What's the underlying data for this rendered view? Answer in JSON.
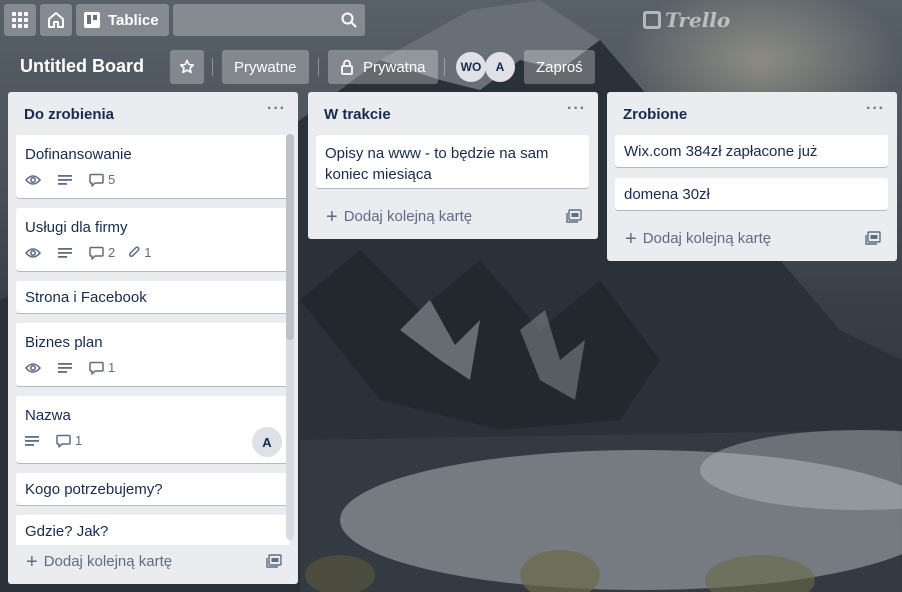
{
  "nav": {
    "boards_label": "Tablice",
    "search_placeholder": "",
    "logo_text": "Trello"
  },
  "board": {
    "title": "Untitled Board",
    "visibility_team": "Prywatne",
    "visibility_private": "Prywatna",
    "members": [
      "WO",
      "A"
    ],
    "invite_label": "Zaproś"
  },
  "lists": [
    {
      "title": "Do zrobienia",
      "cards": [
        {
          "title": "Dofinansowanie",
          "comments": "5"
        },
        {
          "title": "Usługi dla firmy",
          "comments": "2",
          "attachments": "1"
        },
        {
          "title": "Strona i Facebook"
        },
        {
          "title": "Biznes plan",
          "comments": "1"
        },
        {
          "title": "Nazwa",
          "comments": "1",
          "member": "A"
        },
        {
          "title": "Kogo potrzebujemy?"
        },
        {
          "title": "Gdzie? Jak?"
        }
      ],
      "add_label": "Dodaj kolejną kartę"
    },
    {
      "title": "W trakcie",
      "cards": [
        {
          "title": "Opisy na www - to będzie na sam koniec miesiąca"
        }
      ],
      "add_label": "Dodaj kolejną kartę"
    },
    {
      "title": "Zrobione",
      "cards": [
        {
          "title": "Wix.com 384zł zapłacone już"
        },
        {
          "title": "domena 30zł"
        }
      ],
      "add_label": "Dodaj kolejną kartę"
    }
  ],
  "colors": {
    "list_bg": "#ebecf0",
    "card_bg": "#ffffff",
    "text": "#172b4d",
    "muted": "#5e6c84"
  }
}
